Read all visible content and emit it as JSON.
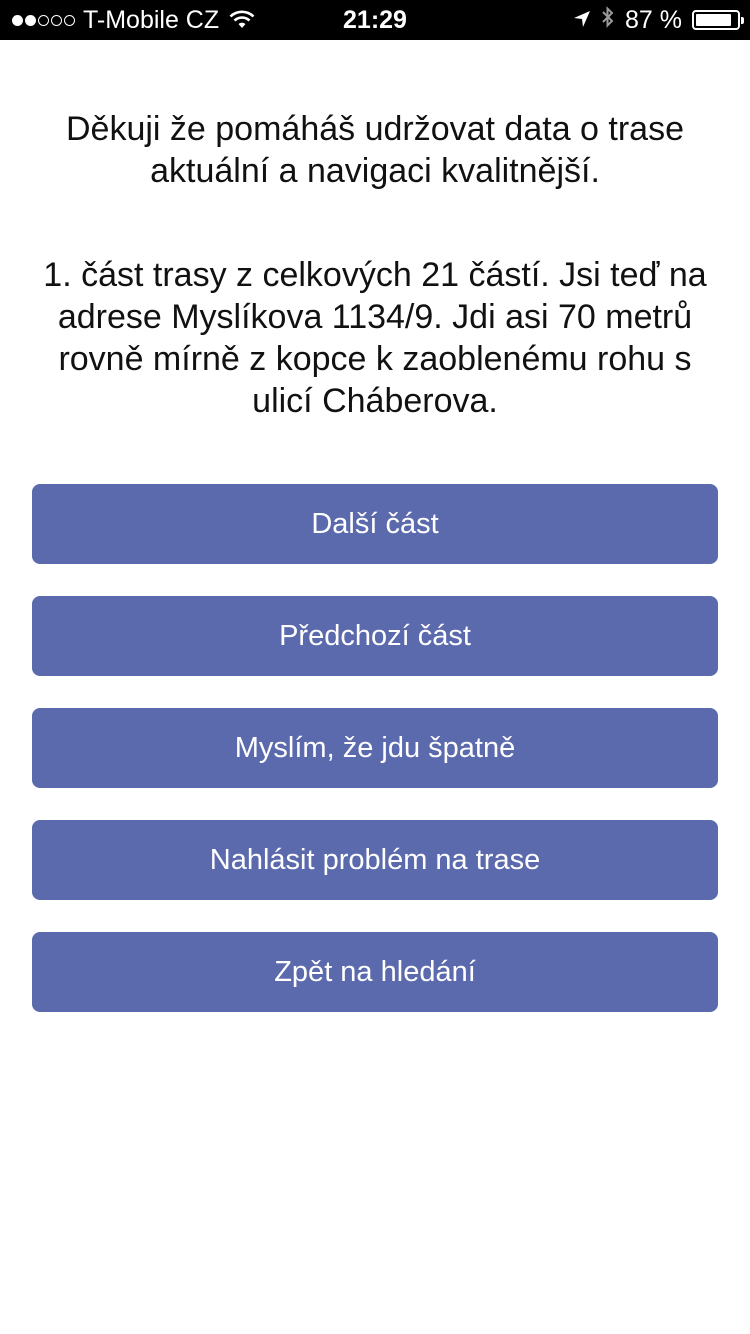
{
  "status_bar": {
    "carrier": "T-Mobile CZ",
    "signal_bars_filled": 2,
    "signal_bars_total": 5,
    "time": "21:29",
    "battery_percent_label": "87 %",
    "battery_level": 0.87,
    "icons": [
      "wifi-icon",
      "location-arrow-icon",
      "bluetooth-icon",
      "battery-icon"
    ]
  },
  "main": {
    "thanks_text": "Děkuji že pomáháš udržovat data o trase aktuální a navigaci kvalitnější.",
    "instruction_text": "1. část trasy z celkových 21 částí. Jsi teď na adrese Myslíkova 1134/9. Jdi asi 70 metrů rovně mírně z kopce k zaoblenému rohu s ulicí Cháberova."
  },
  "buttons": {
    "next_part": "Další část",
    "previous_part": "Předchozí část",
    "wrong_way": "Myslím, že jdu špatně",
    "report_problem": "Nahlásit problém na trase",
    "back_to_search": "Zpět na hledání"
  },
  "colors": {
    "button_bg": "#5b69ad",
    "button_text": "#ffffff",
    "status_bar_bg": "#000000"
  }
}
